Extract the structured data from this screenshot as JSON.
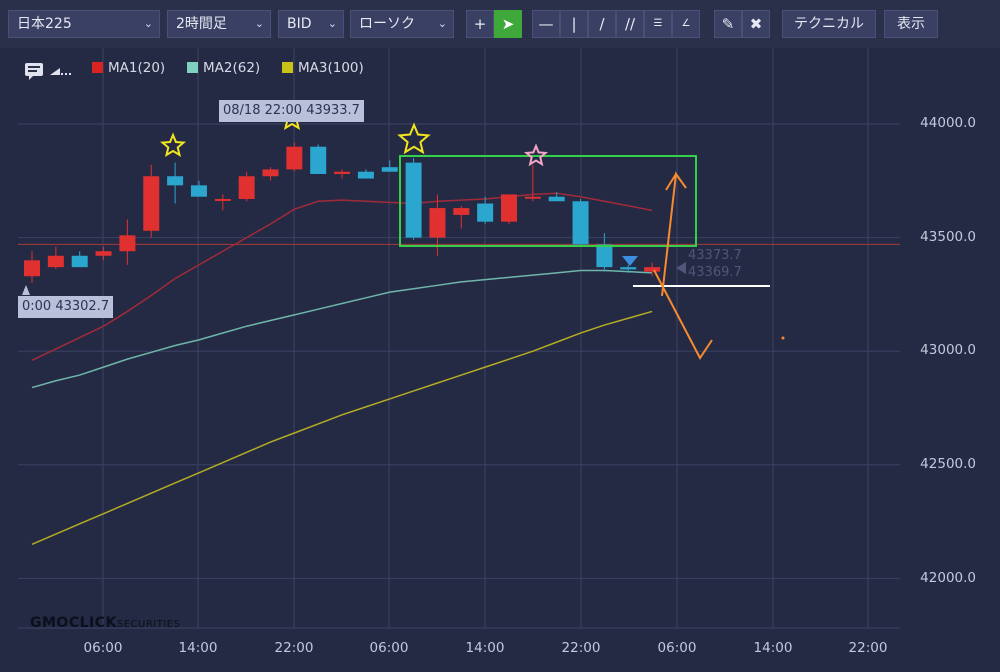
{
  "toolbar": {
    "symbol": "日本225",
    "timeframe": "2時間足",
    "price_type": "BID",
    "chart_style": "ローソク",
    "technical_label": "テクニカル",
    "display_label": "表示",
    "icons": [
      "crosshair-icon",
      "pointer-icon",
      "horizontal-line-icon",
      "vertical-line-icon",
      "trend-line-icon",
      "channel-icon",
      "fibonacci-retracement-icon",
      "fibonacci-fan-icon",
      "eraser-icon",
      "erase-all-icon"
    ]
  },
  "legend": [
    {
      "label": "MA1(20)",
      "color": "#d92424"
    },
    {
      "label": "MA2(62)",
      "color": "#7fd0bd"
    },
    {
      "label": "MA3(100)",
      "color": "#c9c318"
    }
  ],
  "tooltips": {
    "high": "08/18 22:00 43933.7",
    "low": "0:00 43302.7",
    "price_labels": [
      "43373.7",
      "43369.7"
    ]
  },
  "logo": {
    "main": "GMOCLICK",
    "sub": "SECURITIES"
  },
  "chart_data": {
    "type": "candlestick",
    "y_ticks": [
      44000.0,
      43500.0,
      43000.0,
      42500.0,
      42000.0
    ],
    "y_tick_labels": [
      "44000.0",
      "43500.0",
      "43000.0",
      "42500.0",
      "42000.0"
    ],
    "x_tick_labels": [
      "06:00",
      "14:00",
      "22:00",
      "06:00",
      "14:00",
      "22:00",
      "06:00",
      "14:00",
      "22:00"
    ],
    "ylim": [
      41900,
      44160
    ],
    "grid": true,
    "legend_position": "top-left",
    "current_price_line": 43470,
    "candles": [
      {
        "o": 43330,
        "h": 43440,
        "l": 43300,
        "c": 43400
      },
      {
        "o": 43370,
        "h": 43460,
        "l": 43360,
        "c": 43420
      },
      {
        "o": 43420,
        "h": 43440,
        "l": 43370,
        "c": 43370
      },
      {
        "o": 43420,
        "h": 43460,
        "l": 43400,
        "c": 43440
      },
      {
        "o": 43440,
        "h": 43580,
        "l": 43380,
        "c": 43510
      },
      {
        "o": 43530,
        "h": 43820,
        "l": 43500,
        "c": 43770
      },
      {
        "o": 43770,
        "h": 43830,
        "l": 43650,
        "c": 43730
      },
      {
        "o": 43730,
        "h": 43750,
        "l": 43680,
        "c": 43680
      },
      {
        "o": 43670,
        "h": 43690,
        "l": 43620,
        "c": 43670
      },
      {
        "o": 43670,
        "h": 43790,
        "l": 43660,
        "c": 43770
      },
      {
        "o": 43770,
        "h": 43810,
        "l": 43750,
        "c": 43800
      },
      {
        "o": 43800,
        "h": 43920,
        "l": 43790,
        "c": 43900
      },
      {
        "o": 43900,
        "h": 43910,
        "l": 43780,
        "c": 43780
      },
      {
        "o": 43780,
        "h": 43800,
        "l": 43760,
        "c": 43790
      },
      {
        "o": 43790,
        "h": 43800,
        "l": 43760,
        "c": 43760
      },
      {
        "o": 43810,
        "h": 43840,
        "l": 43790,
        "c": 43790
      },
      {
        "o": 43830,
        "h": 43850,
        "l": 43490,
        "c": 43500
      },
      {
        "o": 43500,
        "h": 43690,
        "l": 43420,
        "c": 43630
      },
      {
        "o": 43600,
        "h": 43640,
        "l": 43540,
        "c": 43630
      },
      {
        "o": 43650,
        "h": 43680,
        "l": 43560,
        "c": 43570
      },
      {
        "o": 43570,
        "h": 43690,
        "l": 43560,
        "c": 43690
      },
      {
        "o": 43680,
        "h": 43820,
        "l": 43660,
        "c": 43680
      },
      {
        "o": 43680,
        "h": 43700,
        "l": 43660,
        "c": 43660
      },
      {
        "o": 43660,
        "h": 43670,
        "l": 43460,
        "c": 43470
      },
      {
        "o": 43470,
        "h": 43520,
        "l": 43350,
        "c": 43370
      },
      {
        "o": 43370,
        "h": 43380,
        "l": 43345,
        "c": 43360
      },
      {
        "o": 43350,
        "h": 43390,
        "l": 43330,
        "c": 43370
      }
    ],
    "series": [
      {
        "name": "MA1(20)",
        "color": "#a12a3a",
        "values": [
          42960,
          43010,
          43060,
          43110,
          43175,
          43245,
          43320,
          43380,
          43440,
          43500,
          43560,
          43625,
          43660,
          43665,
          43660,
          43655,
          43650,
          43660,
          43665,
          43670,
          43680,
          43690,
          43695,
          43680,
          43660,
          43640,
          43620
        ]
      },
      {
        "name": "MA2(62)",
        "color": "#6fb6aa",
        "values": [
          42840,
          42870,
          42895,
          42930,
          42965,
          42995,
          43025,
          43050,
          43080,
          43110,
          43135,
          43160,
          43185,
          43210,
          43235,
          43260,
          43275,
          43290,
          43305,
          43315,
          43325,
          43335,
          43345,
          43355,
          43355,
          43350,
          43345
        ]
      },
      {
        "name": "MA3(100)",
        "color": "#b3ac24",
        "values": [
          42150,
          42195,
          42240,
          42285,
          42330,
          42375,
          42420,
          42465,
          42510,
          42555,
          42600,
          42640,
          42680,
          42720,
          42755,
          42790,
          42825,
          42860,
          42895,
          42930,
          42965,
          43000,
          43040,
          43080,
          43115,
          43145,
          43175
        ]
      }
    ]
  }
}
